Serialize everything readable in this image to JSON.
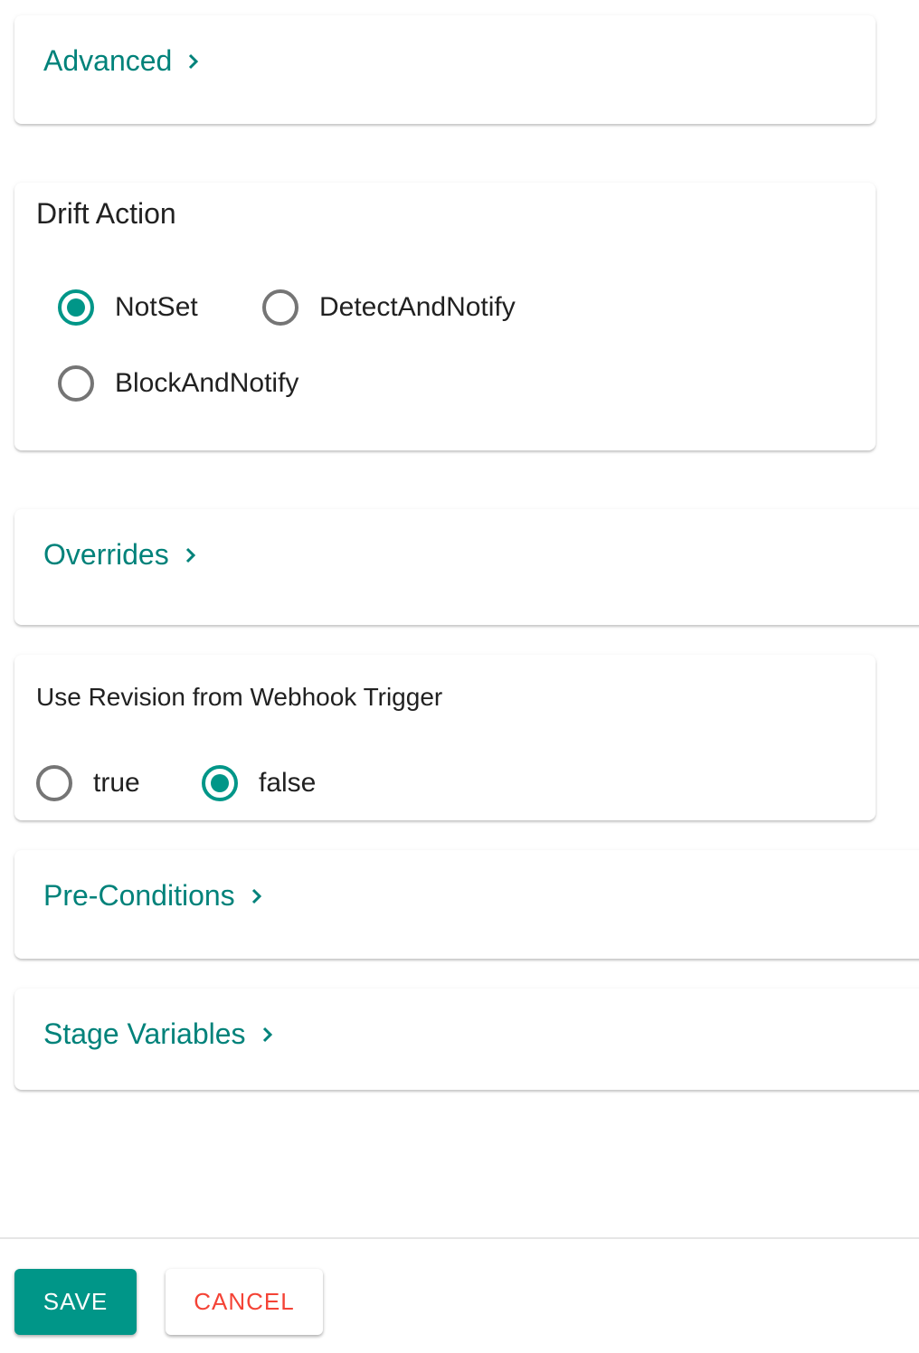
{
  "theme": {
    "accent": "#009688",
    "link": "#00827a",
    "danger": "#f44336"
  },
  "sections": {
    "advanced": {
      "label": "Advanced",
      "icon": "chevron-right-icon"
    },
    "drift_action": {
      "title": "Drift Action",
      "selected": "NotSet",
      "options": [
        {
          "label": "NotSet",
          "checked": true
        },
        {
          "label": "DetectAndNotify",
          "checked": false
        },
        {
          "label": "BlockAndNotify",
          "checked": false
        }
      ]
    },
    "overrides": {
      "label": "Overrides",
      "icon": "chevron-right-icon"
    },
    "webhook_revision": {
      "title": "Use Revision from Webhook Trigger",
      "selected": "false",
      "options": [
        {
          "label": "true",
          "checked": false
        },
        {
          "label": "false",
          "checked": true
        }
      ]
    },
    "pre_conditions": {
      "label": "Pre-Conditions",
      "icon": "chevron-right-icon"
    },
    "stage_variables": {
      "label": "Stage Variables",
      "icon": "chevron-right-icon"
    }
  },
  "footer": {
    "save_label": "SAVE",
    "cancel_label": "CANCEL"
  }
}
